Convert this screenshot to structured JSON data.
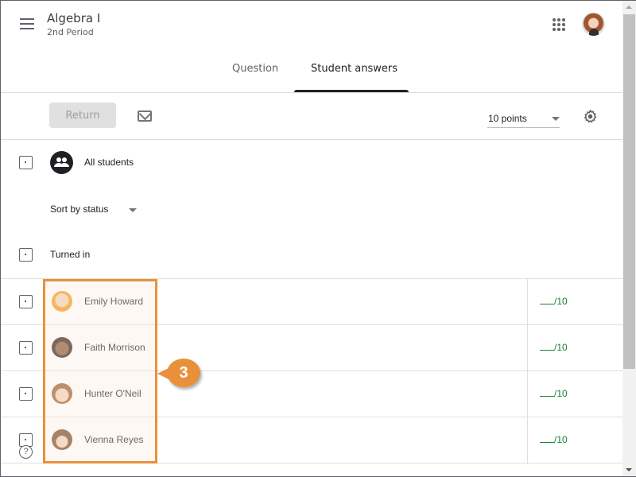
{
  "header": {
    "title": "Algebra I",
    "subtitle": "2nd Period",
    "icons": {
      "menu": "hamburger-menu-icon",
      "apps": "apps-grid-icon",
      "account": "user-avatar"
    }
  },
  "tabs": [
    {
      "label": "Question",
      "active": false
    },
    {
      "label": "Student answers",
      "active": true
    }
  ],
  "toolbar": {
    "return_label": "Return",
    "mail_icon": "envelope-icon",
    "points_value": "10 points",
    "settings_icon": "gear-icon"
  },
  "list": {
    "all_students_label": "All students",
    "sort_label": "Sort by status",
    "section_label": "Turned in",
    "students": [
      {
        "name": "Emily Howard",
        "grade": "/10"
      },
      {
        "name": "Faith Morrison",
        "grade": "/10"
      },
      {
        "name": "Hunter O'Neil",
        "grade": "/10"
      },
      {
        "name": "Vienna Reyes",
        "grade": "/10"
      }
    ]
  },
  "annotation": {
    "callout_number": "3",
    "highlight_color": "#e8913a"
  },
  "colors": {
    "grade_green": "#188038",
    "text_primary": "#202124",
    "text_secondary": "#5f6368"
  }
}
